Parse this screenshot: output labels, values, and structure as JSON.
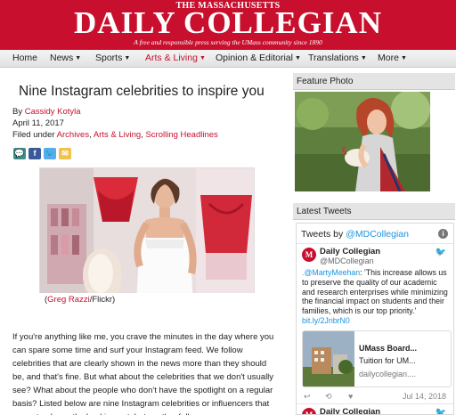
{
  "masthead": {
    "top_line": "THE MASSACHUSETTS",
    "title": "DAILY COLLEGIAN",
    "tagline": "A free and responsible press serving the UMass community since 1890"
  },
  "nav": {
    "items": [
      {
        "label": "Home",
        "dropdown": false,
        "active": false
      },
      {
        "label": "News",
        "dropdown": true,
        "active": false
      },
      {
        "label": "Sports",
        "dropdown": true,
        "active": false
      },
      {
        "label": "Arts & Living",
        "dropdown": true,
        "active": true
      },
      {
        "label": "Opinion & Editorial",
        "dropdown": true,
        "active": false
      },
      {
        "label": "Translations",
        "dropdown": true,
        "active": false
      },
      {
        "label": "More",
        "dropdown": true,
        "active": false
      }
    ],
    "caret": "▼"
  },
  "article": {
    "title": "Nine Instagram celebrities to inspire you",
    "by_prefix": "By ",
    "author": "Cassidy Kotyla",
    "date": "April 11, 2017",
    "filed_prefix": "Filed under ",
    "categories": [
      "Archives",
      "Arts & Living",
      "Scrolling Headlines"
    ],
    "category_sep": ", ",
    "photo_caption_open": "(",
    "photo_credit": "Greg Razzi",
    "photo_caption_rest": "/Flickr)",
    "body": "If you're anything like me, you crave the minutes in the day where you can spare some time and surf your Instagram feed. We follow celebrities that are clearly shown in the news more than they should be, and that's fine. But what about the celebrities that we don't usually see? What about the people who don't have the spotlight on a regular basis? Listed below are nine Instagram celebrities or influencers that are not only worth checking out, but worth a follow."
  },
  "share": [
    {
      "icon": "comment-icon",
      "glyph": "💬",
      "color": "#3b8f88"
    },
    {
      "icon": "facebook-icon",
      "glyph": "f",
      "color": "#3b5998"
    },
    {
      "icon": "twitter-icon",
      "glyph": "🐦",
      "color": "#55acee"
    },
    {
      "icon": "email-icon",
      "glyph": "✉",
      "color": "#f0c24b"
    }
  ],
  "sidebar": {
    "feature_title": "Feature Photo",
    "tweets_title": "Latest Tweets"
  },
  "twitter": {
    "header_prefix": "Tweets",
    "header_by": " by ",
    "header_handle": "@MDCollegian",
    "info": "i",
    "avatar_letter": "M",
    "tweets": [
      {
        "name": "Daily Collegian",
        "handle": "@MDCollegian",
        "mention": ".@MartyMeehan",
        "text": ": 'This increase allows us to preserve the quality of our academic and research enterprises while minimizing the financial impact on students and their families, which is our top priority.' ",
        "link": "bit.ly/2JnbrN0",
        "card_title": "UMass Board...",
        "card_desc": "Tuition for UM...",
        "card_url": "dailycollegian....",
        "date": "Jul 14, 2018"
      },
      {
        "name": "Daily Collegian",
        "handle": "@MDCollegian"
      }
    ],
    "actions": [
      "↩",
      "⟲",
      "♥"
    ],
    "bird": "🐦"
  }
}
